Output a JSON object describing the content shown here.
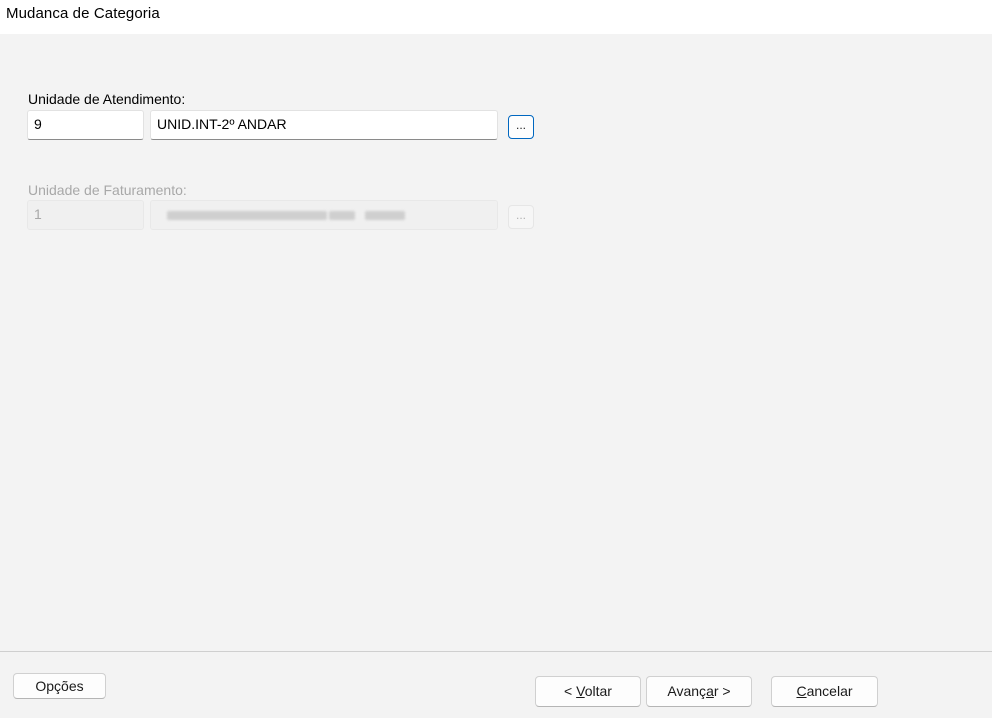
{
  "window": {
    "title": "Mudanca de  Categoria"
  },
  "unidade_atendimento": {
    "label": "Unidade de Atendimento:",
    "code": "9",
    "name": "UNID.INT-2º ANDAR",
    "browse_label": "..."
  },
  "unidade_faturamento": {
    "label": "Unidade de Faturamento:",
    "code": "1",
    "name_redacted": true,
    "browse_label": "..."
  },
  "footer": {
    "opcoes_label": "Opções",
    "voltar_prefix": "< ",
    "voltar_key": "V",
    "voltar_rest": "oltar",
    "avancar_prefix": "Avanç",
    "avancar_key": "a",
    "avancar_rest": "r >",
    "cancelar_key": "C",
    "cancelar_rest": "ancelar"
  }
}
